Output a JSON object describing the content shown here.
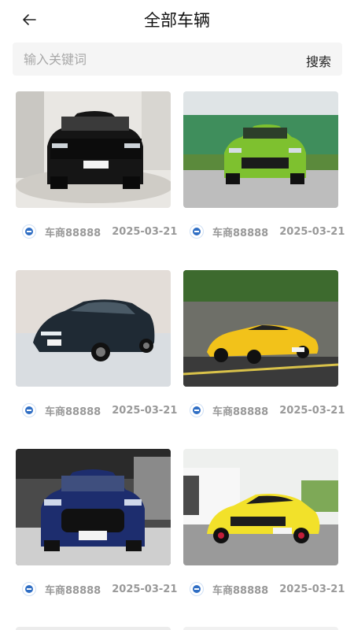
{
  "header": {
    "title": "全部车辆",
    "back_icon": "back-arrow-icon"
  },
  "search": {
    "placeholder": "输入关键词",
    "value": "",
    "button_label": "搜索"
  },
  "colors": {
    "background": "#ffffff",
    "search_bg": "#f5f5f5",
    "meta_text": "#999999"
  },
  "listings": [
    {
      "dealer": "车商88888",
      "date": "2025-03-21",
      "car": "black-suv"
    },
    {
      "dealer": "车商88888",
      "date": "2025-03-21",
      "car": "green-suv"
    },
    {
      "dealer": "车商88888",
      "date": "2025-03-21",
      "car": "dark-sedan"
    },
    {
      "dealer": "车商88888",
      "date": "2025-03-21",
      "car": "yellow-coupe"
    },
    {
      "dealer": "车商88888",
      "date": "2025-03-21",
      "car": "blue-suv"
    },
    {
      "dealer": "车商88888",
      "date": "2025-03-21",
      "car": "yellow-suv"
    }
  ]
}
